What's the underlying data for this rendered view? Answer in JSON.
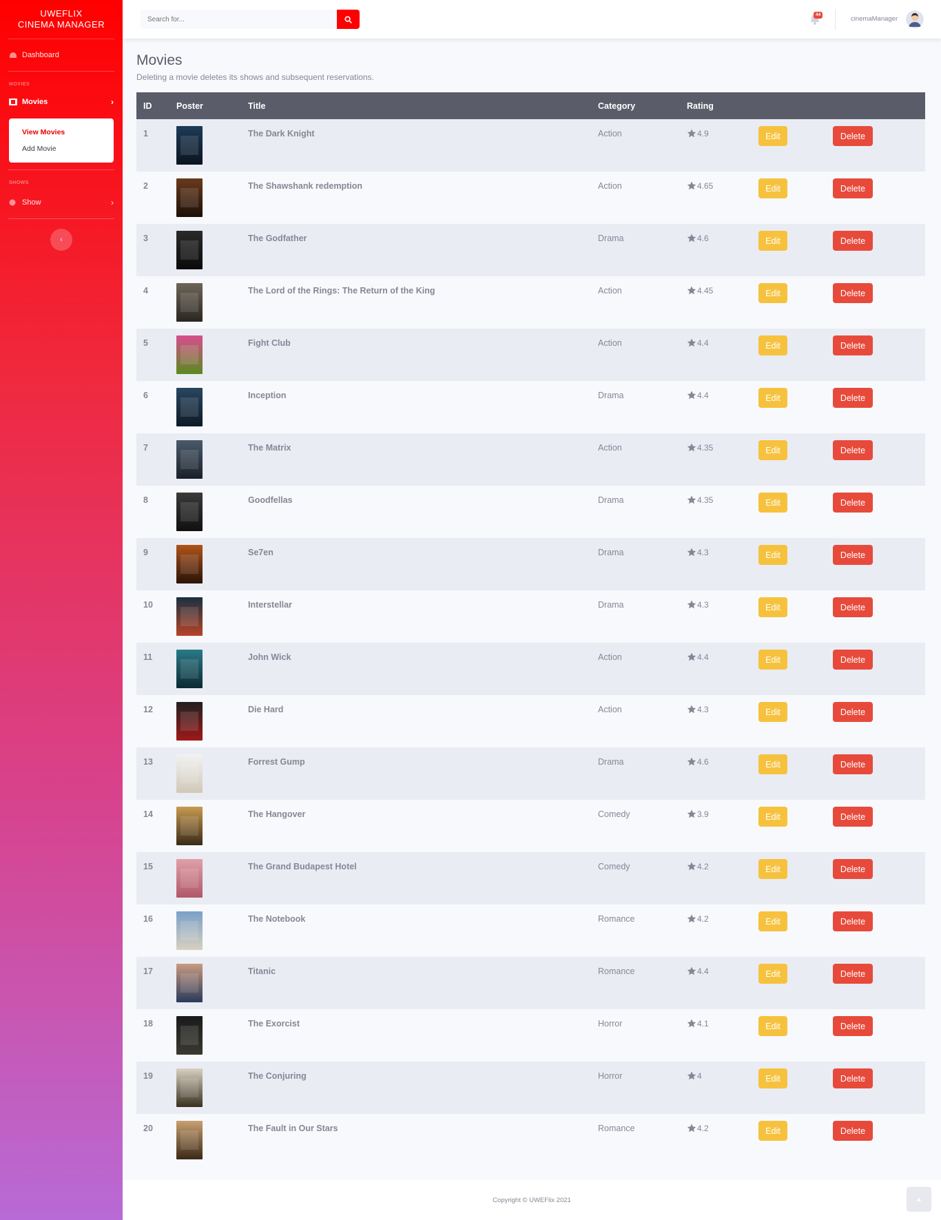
{
  "sidebar": {
    "brand_line1": "UWEFLIX",
    "brand_line2": "CINEMA MANAGER",
    "dashboard_label": "Dashboard",
    "movies_heading": "MOVIES",
    "movies_label": "Movies",
    "movies_submenu": [
      "View Movies",
      "Add Movie"
    ],
    "shows_heading": "SHOWS",
    "show_label": "Show",
    "toggle_icon": "chevron-left-icon"
  },
  "topbar": {
    "search_placeholder": "Search for...",
    "notification_count": "44",
    "user_name": "cinemaManager"
  },
  "page": {
    "title": "Movies",
    "subtitle": "Deleting a movie deletes its shows and subsequent reservations."
  },
  "table": {
    "headers": [
      "ID",
      "Poster",
      "Title",
      "Category",
      "Rating"
    ],
    "edit_label": "Edit",
    "delete_label": "Delete",
    "rows": [
      {
        "id": "1",
        "title": "The Dark Knight",
        "category": "Action",
        "rating": "4.9",
        "poster_colors": [
          "#1d3a57",
          "#0b1420"
        ]
      },
      {
        "id": "2",
        "title": "The Shawshank redemption",
        "category": "Action",
        "rating": "4.65",
        "poster_colors": [
          "#6a3a1c",
          "#1c0f08"
        ]
      },
      {
        "id": "3",
        "title": "The Godfather",
        "category": "Drama",
        "rating": "4.6",
        "poster_colors": [
          "#2a2a2a",
          "#0a0a0a"
        ]
      },
      {
        "id": "4",
        "title": "The Lord of the Rings: The Return of the King",
        "category": "Action",
        "rating": "4.45",
        "poster_colors": [
          "#6d6658",
          "#2a2620"
        ]
      },
      {
        "id": "5",
        "title": "Fight Club",
        "category": "Action",
        "rating": "4.4",
        "poster_colors": [
          "#d84d8c",
          "#5a8a20"
        ]
      },
      {
        "id": "6",
        "title": "Inception",
        "category": "Drama",
        "rating": "4.4",
        "poster_colors": [
          "#2a4660",
          "#0c1a26"
        ]
      },
      {
        "id": "7",
        "title": "The Matrix",
        "category": "Action",
        "rating": "4.35",
        "poster_colors": [
          "#4a5a6a",
          "#1a2028"
        ]
      },
      {
        "id": "8",
        "title": "Goodfellas",
        "category": "Drama",
        "rating": "4.35",
        "poster_colors": [
          "#3a3a3a",
          "#101010"
        ]
      },
      {
        "id": "9",
        "title": "Se7en",
        "category": "Drama",
        "rating": "4.3",
        "poster_colors": [
          "#b0541a",
          "#2a1206"
        ]
      },
      {
        "id": "10",
        "title": "Interstellar",
        "category": "Drama",
        "rating": "4.3",
        "poster_colors": [
          "#1a3040",
          "#b84428"
        ]
      },
      {
        "id": "11",
        "title": "John Wick",
        "category": "Action",
        "rating": "4.4",
        "poster_colors": [
          "#2a7a88",
          "#0c2a32"
        ]
      },
      {
        "id": "12",
        "title": "Die Hard",
        "category": "Action",
        "rating": "4.3",
        "poster_colors": [
          "#202020",
          "#a01818"
        ]
      },
      {
        "id": "13",
        "title": "Forrest Gump",
        "category": "Drama",
        "rating": "4.6",
        "poster_colors": [
          "#f2f2f2",
          "#d0c8b8"
        ]
      },
      {
        "id": "14",
        "title": "The Hangover",
        "category": "Comedy",
        "rating": "3.9",
        "poster_colors": [
          "#c89a50",
          "#3a2a18"
        ]
      },
      {
        "id": "15",
        "title": "The Grand Budapest Hotel",
        "category": "Comedy",
        "rating": "4.2",
        "poster_colors": [
          "#e0a0a8",
          "#b05868"
        ]
      },
      {
        "id": "16",
        "title": "The Notebook",
        "category": "Romance",
        "rating": "4.2",
        "poster_colors": [
          "#7aa0c8",
          "#d8d0c0"
        ]
      },
      {
        "id": "17",
        "title": "Titanic",
        "category": "Romance",
        "rating": "4.4",
        "poster_colors": [
          "#c89a80",
          "#2a3a5a"
        ]
      },
      {
        "id": "18",
        "title": "The Exorcist",
        "category": "Horror",
        "rating": "4.1",
        "poster_colors": [
          "#1a1a1a",
          "#3a3a30"
        ]
      },
      {
        "id": "19",
        "title": "The Conjuring",
        "category": "Horror",
        "rating": "4",
        "poster_colors": [
          "#d8d0c0",
          "#3a3020"
        ]
      },
      {
        "id": "20",
        "title": "The Fault in Our Stars",
        "category": "Romance",
        "rating": "4.2",
        "poster_colors": [
          "#c8a070",
          "#3a2818"
        ]
      }
    ]
  },
  "footer": {
    "copyright": "Copyright © UWEFlix 2021"
  },
  "colors": {
    "brand_red": "#ff0000",
    "edit_yellow": "#f6c23e",
    "delete_red": "#e74a3b",
    "header_gray": "#5a5c69"
  }
}
